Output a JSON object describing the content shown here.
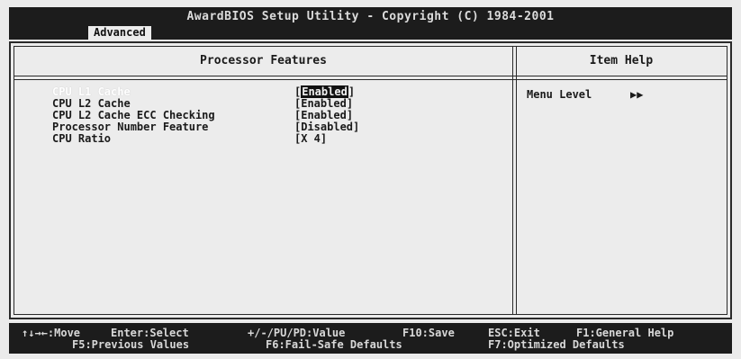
{
  "title": "AwardBIOS Setup Utility - Copyright (C) 1984-2001",
  "active_tab": "Advanced",
  "left_pane_title": "Processor Features",
  "right_pane_title": "Item Help",
  "settings": [
    {
      "label": "CPU L1 Cache",
      "value_prefix": "[",
      "value": "Enabled",
      "value_suffix": "]"
    },
    {
      "label": "CPU L2 Cache",
      "value_prefix": "[",
      "value": "Enabled",
      "value_suffix": "]"
    },
    {
      "label": "CPU L2 Cache ECC Checking",
      "value_prefix": "[",
      "value": "Enabled",
      "value_suffix": "]"
    },
    {
      "label": "Processor Number Feature",
      "value_prefix": "[",
      "value": "Disabled",
      "value_suffix": "]"
    },
    {
      "label": "CPU Ratio",
      "value_prefix": "[",
      "value": "X 4",
      "value_suffix": "]"
    }
  ],
  "help": {
    "menu_level_label": "Menu Level",
    "menu_level_arrows": "▶▶"
  },
  "keys": {
    "move": "↑↓→←:Move",
    "enter": "Enter:Select",
    "value": "+/-/PU/PD:Value",
    "save": "F10:Save",
    "exit": "ESC:Exit",
    "general_help": "F1:General Help",
    "previous": "F5:Previous Values",
    "failsafe": "F6:Fail-Safe Defaults",
    "optimized": "F7:Optimized Defaults"
  }
}
